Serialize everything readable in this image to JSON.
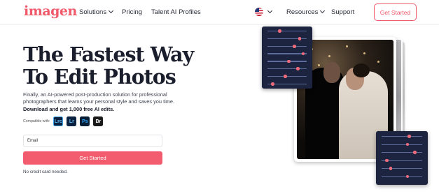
{
  "nav": {
    "logo": "imagen",
    "links": [
      {
        "label": "Solutions",
        "dropdown": true
      },
      {
        "label": "Pricing",
        "dropdown": false
      },
      {
        "label": "Talent AI Profiles",
        "dropdown": false
      },
      {
        "label": "Resources",
        "dropdown": true
      },
      {
        "label": "Support",
        "dropdown": false
      }
    ],
    "language_icon": "us-flag-icon",
    "cta_label": "Get Started"
  },
  "hero": {
    "title_line1": "The Fastest Way",
    "title_line2": "To Edit Photos",
    "description": "Finally, an AI-powered post-production solution for professional photographers that learns your personal style and saves you time.",
    "description_bold": "Download and get 1,000 free AI edits.",
    "compatible_label": "Compatible with:",
    "apps": [
      "Lrc",
      "Lr",
      "Ps",
      "Br"
    ],
    "email_placeholder": "Email",
    "cta_label": "Get Started",
    "note": "No credit card needed."
  },
  "collage": {
    "panel_a_levels": [
      0.3,
      0.85,
      0.7,
      0.95,
      0.55,
      0.8,
      0.45,
      0.1
    ],
    "panel_b_levels": [
      0.7,
      0.65,
      0.85,
      0.1,
      0.2,
      0.65
    ],
    "knob_color": "#f06b7c"
  },
  "colors": {
    "brand": "#f05a6b",
    "panel_bg": "#1c2440"
  }
}
